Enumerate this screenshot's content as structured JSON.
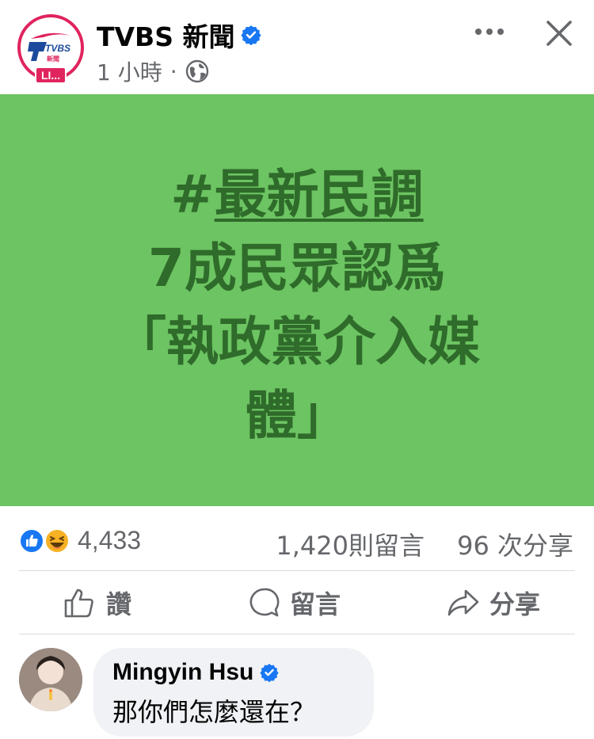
{
  "header": {
    "page_name": "TVBS 新聞",
    "timestamp": "1 小時",
    "separator": "·",
    "live_badge": "LI...",
    "logo_text": "TVBS",
    "logo_subtext": "新聞"
  },
  "post_card": {
    "hashtag_symbol": "#",
    "hashtag_word": "最新民調",
    "line2": "7成民眾認爲",
    "line3": "「執政黨介入媒",
    "line4": "體」",
    "background_color": "#6cc462",
    "text_color": "#2f6b2a"
  },
  "stats": {
    "reactions": "4,433",
    "comments": "1,420則留言",
    "shares": "96 次分享"
  },
  "actions": {
    "like": "讚",
    "comment": "留言",
    "share": "分享"
  },
  "comment": {
    "author": "Mingyin Hsu",
    "text": "那你們怎麼還在？"
  },
  "colors": {
    "verified_blue": "#1877f2",
    "live_red": "#e0245e",
    "secondary_text": "#65676b"
  }
}
